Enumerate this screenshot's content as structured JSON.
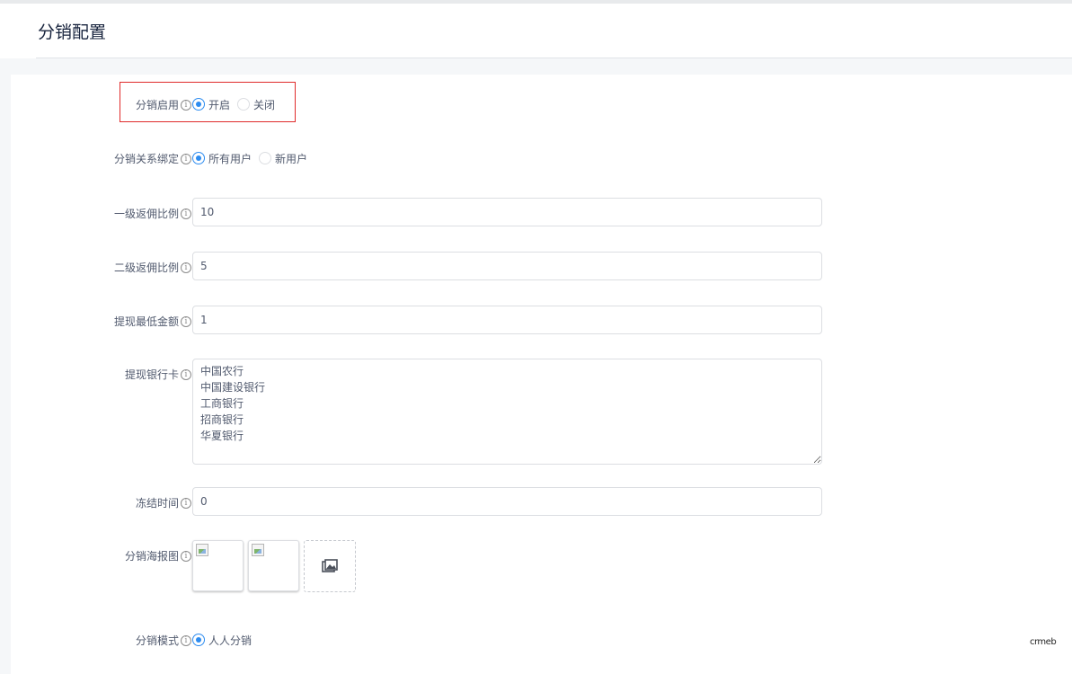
{
  "page": {
    "title": "分销配置",
    "logo_text": "crmeb"
  },
  "form": {
    "enable": {
      "label": "分销启用",
      "options": [
        {
          "label": "开启",
          "checked": true
        },
        {
          "label": "关闭",
          "checked": false
        }
      ]
    },
    "binding": {
      "label": "分销关系绑定",
      "options": [
        {
          "label": "所有用户",
          "checked": true
        },
        {
          "label": "新用户",
          "checked": false
        }
      ]
    },
    "level1_rate": {
      "label": "一级返佣比例",
      "value": "10"
    },
    "level2_rate": {
      "label": "二级返佣比例",
      "value": "5"
    },
    "min_withdraw": {
      "label": "提现最低金额",
      "value": "1"
    },
    "bank_cards": {
      "label": "提现银行卡",
      "value": "中国农行\n中国建设银行\n工商银行\n招商银行\n华夏银行"
    },
    "freeze_time": {
      "label": "冻结时间",
      "value": "0"
    },
    "poster": {
      "label": "分销海报图",
      "images": [
        "broken-image",
        "broken-image"
      ],
      "upload_icon": "image-upload-icon"
    },
    "mode": {
      "label": "分销模式",
      "options": [
        {
          "label": "人人分销",
          "checked": true
        }
      ]
    }
  },
  "colors": {
    "accent": "#2d8cf0",
    "highlight_border": "#e02b2b"
  }
}
